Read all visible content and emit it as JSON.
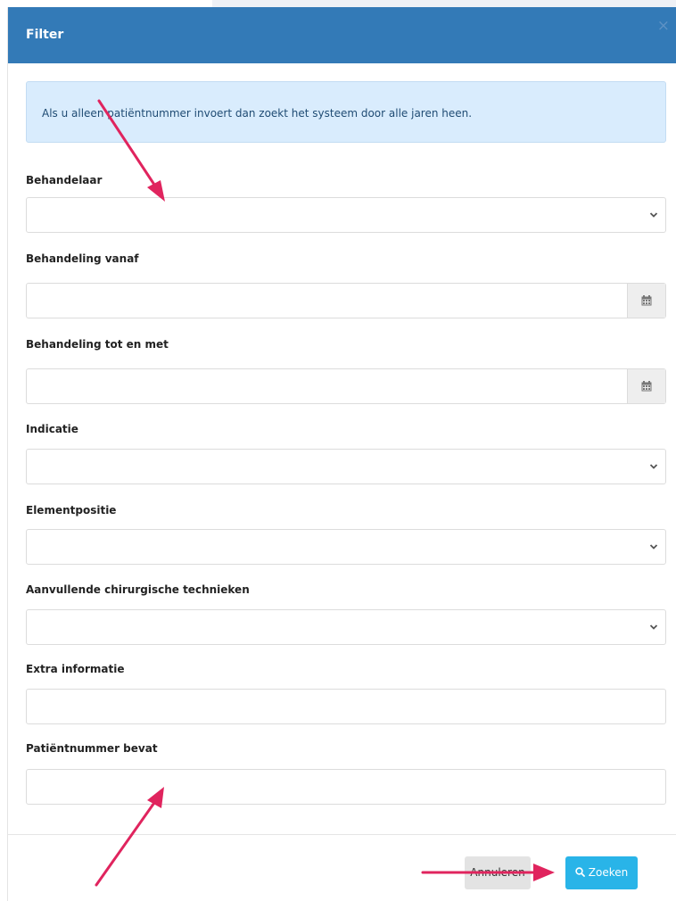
{
  "modal": {
    "title": "Filter",
    "close_label": "×"
  },
  "alert": {
    "text": "Als u alleen patiëntnummer invoert dan zoekt het systeem door alle jaren heen."
  },
  "form": {
    "behandelaar": {
      "label": "Behandelaar",
      "value": ""
    },
    "behandeling_vanaf": {
      "label": "Behandeling vanaf",
      "value": ""
    },
    "behandeling_tot": {
      "label": "Behandeling tot en met",
      "value": ""
    },
    "indicatie": {
      "label": "Indicatie",
      "value": ""
    },
    "elementpositie": {
      "label": "Elementpositie",
      "value": ""
    },
    "technieken": {
      "label": "Aanvullende chirurgische technieken",
      "value": ""
    },
    "extra_info": {
      "label": "Extra informatie",
      "value": ""
    },
    "patientnummer": {
      "label": "Patiëntnummer bevat",
      "value": ""
    }
  },
  "footer": {
    "cancel_label": "Annuleren",
    "search_label": "Zoeken"
  },
  "colors": {
    "header": "#337ab7",
    "alert_bg": "#d9ecfd",
    "search_button": "#29b4e8",
    "annotation_arrow": "#e0245e"
  },
  "icons": {
    "close": "close-icon",
    "calendar": "calendar-icon",
    "chevron": "chevron-down-icon",
    "search": "search-icon"
  }
}
